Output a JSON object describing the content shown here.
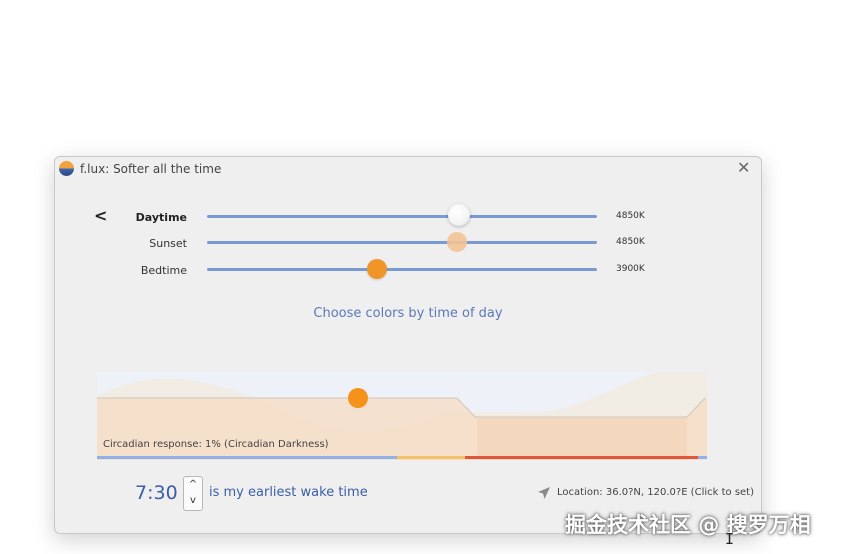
{
  "window": {
    "title": "f.lux: Softer all the time",
    "close_glyph": "✕",
    "app_icon": "flux-logo-icon"
  },
  "nav": {
    "back_label": "<"
  },
  "sliders": [
    {
      "label": "Daytime",
      "value_text": "4850K",
      "level": 0.64,
      "thumb_color": "#ffffff",
      "active": true
    },
    {
      "label": "Sunset",
      "value_text": "4850K",
      "level": 0.64,
      "thumb_color": "#f4c394",
      "active": false
    },
    {
      "label": "Bedtime",
      "value_text": "3900K",
      "level": 0.43,
      "thumb_color": "#f09628",
      "active": false
    }
  ],
  "choose_colors_link": "Choose colors by time of day",
  "graph": {
    "circadian_text": "Circadian response: 1% (Circadian Darkness)",
    "bar_colors": [
      "#8fb0e8",
      "#f5c26a",
      "#e2553a",
      "#8fb0e8"
    ]
  },
  "wake": {
    "time": "7:30",
    "spin_up": "^",
    "spin_down": "v",
    "text": "is my earliest wake time"
  },
  "location": {
    "icon": "location-arrow-icon",
    "text": "Location: 36.0?N, 120.0?E (Click to set)"
  },
  "watermark": "掘金技术社区 @ 搜罗万相",
  "colors": {
    "accent": "#5b79b8",
    "track": "#7a9bd1",
    "sun": "#f5921c"
  }
}
